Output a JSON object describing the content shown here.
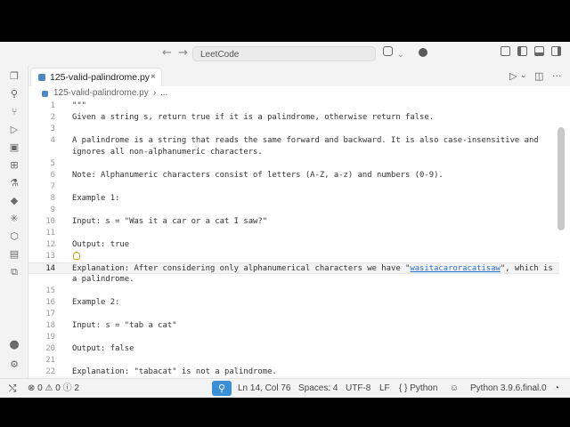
{
  "titlebar": {
    "command_center": "LeetCode",
    "back_arrow": "←",
    "forward_arrow": "→"
  },
  "tabs": [
    {
      "label": "125-valid-palindrome.py",
      "close": "×"
    }
  ],
  "breadcrumb": {
    "file": "125-valid-palindrome.py",
    "sep": "›",
    "more": "..."
  },
  "editor": {
    "lines": [
      {
        "n": "1",
        "text": "\"\"\""
      },
      {
        "n": "2",
        "text": "Given a string s, return true if it is a palindrome, otherwise return false."
      },
      {
        "n": "3",
        "text": ""
      },
      {
        "n": "4",
        "text": "A palindrome is a string that reads the same forward and backward. It is also case-insensitive and"
      },
      {
        "n": "",
        "text": "ignores all non-alphanumeric characters."
      },
      {
        "n": "5",
        "text": ""
      },
      {
        "n": "6",
        "text": "Note: Alphanumeric characters consist of letters (A-Z, a-z) and numbers (0-9)."
      },
      {
        "n": "7",
        "text": ""
      },
      {
        "n": "8",
        "text": "Example 1:"
      },
      {
        "n": "9",
        "text": ""
      },
      {
        "n": "10",
        "text": "Input: s = \"Was it a car or a cat I saw?\""
      },
      {
        "n": "11",
        "text": ""
      },
      {
        "n": "12",
        "text": "Output: true"
      },
      {
        "n": "13",
        "text": ""
      },
      {
        "n": "14",
        "text": "Explanation: After considering only alphanumerical characters we have \"wasitacaroracatisaw\", which is"
      },
      {
        "n": "",
        "text": "a palindrome."
      },
      {
        "n": "15",
        "text": ""
      },
      {
        "n": "16",
        "text": "Example 2:"
      },
      {
        "n": "17",
        "text": ""
      },
      {
        "n": "18",
        "text": "Input: s = \"tab a cat\""
      },
      {
        "n": "19",
        "text": ""
      },
      {
        "n": "20",
        "text": "Output: false"
      },
      {
        "n": "21",
        "text": ""
      },
      {
        "n": "22",
        "text": "Explanation: \"tabacat\" is not a palindrome."
      }
    ],
    "line14_prefix": "Explanation: After considering only alphanumerical characters we have \"",
    "line14_highlight": "wasitacaroracatisaw",
    "line14_suffix": "\", which is"
  },
  "status": {
    "errors": "0",
    "warnings": "0",
    "info": "2",
    "position": "Ln 14, Col 76",
    "spaces": "Spaces: 4",
    "encoding": "UTF-8",
    "eol": "LF",
    "language": "Python",
    "language_icon": "{ }",
    "interpreter": "Python 3.9.6.final.0"
  },
  "colors": {
    "accent": "#3a8fd9",
    "python_icon": "#4a88c7",
    "lightbulb": "#c9a21a"
  },
  "icons": [
    "explorer-icon",
    "search-icon",
    "source-control-icon",
    "run-debug-icon",
    "remote-explorer-icon",
    "extensions-icon",
    "testing-icon",
    "python-icon",
    "docker-icon",
    "leetcode-icon",
    "database-icon",
    "accounts-icon",
    "settings-icon"
  ]
}
